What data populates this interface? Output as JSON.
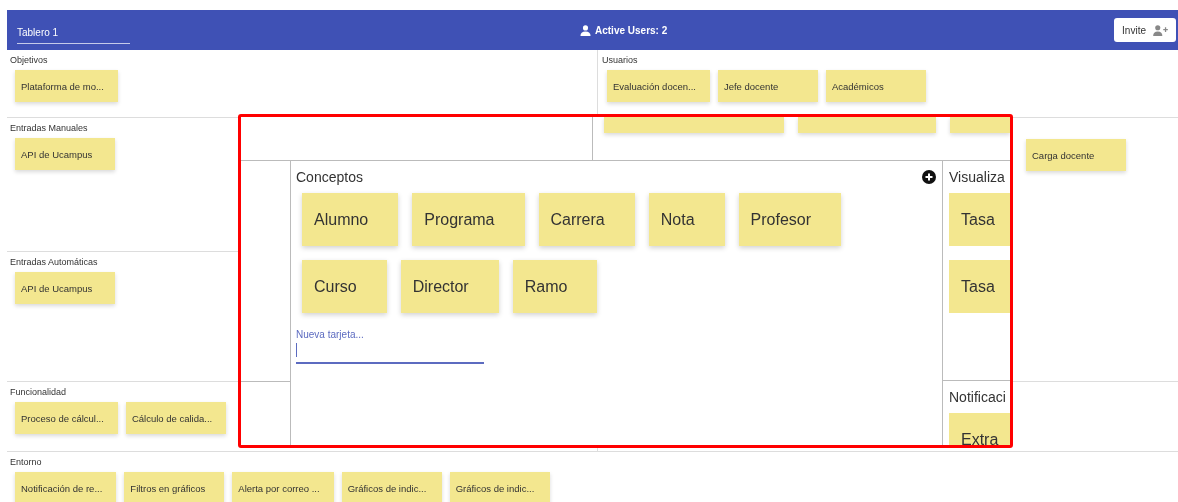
{
  "header": {
    "board_name": "Tablero 1",
    "active_users": "Active Users: 2",
    "invite_button": "Invite"
  },
  "board": {
    "left_sections": [
      {
        "title": "Objetivos",
        "cards": [
          "Plataforma de mo..."
        ]
      },
      {
        "title": "Entradas Manuales",
        "cards": [
          "API de Ucampus"
        ]
      },
      {
        "title": "Entradas Automáticas",
        "cards": [
          "API de Ucampus"
        ]
      },
      {
        "title": "Funcionalidad",
        "cards": [
          "Proceso de cálcul...",
          "Cálculo de calida..."
        ]
      }
    ],
    "right_sections": [
      {
        "title": "Usuarios",
        "cards": [
          "Evaluación docen...",
          "Jefe docente",
          "Académicos"
        ]
      },
      {
        "cards": [
          "Carga docente"
        ]
      }
    ],
    "bottom_section": {
      "title": "Entorno",
      "cards": [
        "Notificación de re...",
        "Filtros en gráficos",
        "Alerta por correo ...",
        "Gráficos de indic...",
        "Gráficos de indic..."
      ]
    }
  },
  "magnifier": {
    "top_row": [
      {
        "kind": "card"
      },
      {
        "kind": "card"
      },
      {
        "kind": "card"
      }
    ],
    "concepts": {
      "title": "Conceptos",
      "cards": [
        "Alumno",
        "Programa",
        "Carrera",
        "Nota",
        "Profesor",
        "Curso",
        "Director",
        "Ramo"
      ],
      "new_card": {
        "label": "Nueva tarjeta...",
        "focused": true
      }
    },
    "side_sections": [
      {
        "title": "Visualiza",
        "cards": [
          "Tasa",
          "Tasa"
        ]
      },
      {
        "title": "Notificaci",
        "cards": [
          "Extra"
        ]
      }
    ]
  }
}
